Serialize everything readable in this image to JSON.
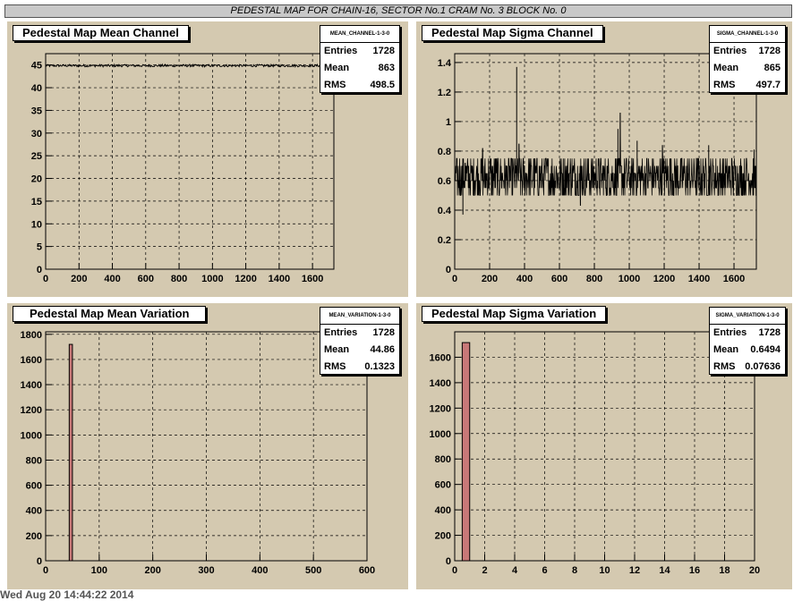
{
  "page": {
    "header": "PEDESTAL MAP FOR CHAIN-16, SECTOR No.1 CRAM No. 3 BLOCK No. 0",
    "footer": "Wed Aug 20 14:44:22 2014"
  },
  "colors": {
    "pad_bg": "#d4c9b0",
    "bar_fill": "#c87878",
    "line": "#000000"
  },
  "panels": [
    {
      "title": "Pedestal Map Mean Channel",
      "stats": {
        "name": "MEAN_CHANNEL-1-3-0",
        "entries_label": "Entries",
        "entries": "1728",
        "mean_label": "Mean",
        "mean": "863",
        "rms_label": "RMS",
        "rms": "498.5"
      }
    },
    {
      "title": "Pedestal Map Sigma Channel",
      "stats": {
        "name": "SIGMA_CHANNEL-1-3-0",
        "entries_label": "Entries",
        "entries": "1728",
        "mean_label": "Mean",
        "mean": "865",
        "rms_label": "RMS",
        "rms": "497.7"
      }
    },
    {
      "title": "Pedestal Map Mean Variation",
      "stats": {
        "name": "MEAN_VARIATION-1-3-0",
        "entries_label": "Entries",
        "entries": "1728",
        "mean_label": "Mean",
        "mean": "44.86",
        "rms_label": "RMS",
        "rms": "0.1323"
      }
    },
    {
      "title": "Pedestal Map Sigma Variation",
      "stats": {
        "name": "SIGMA_VARIATION-1-3-0",
        "entries_label": "Entries",
        "entries": "1728",
        "mean_label": "Mean",
        "mean": "0.6494",
        "rms_label": "RMS",
        "rms": "0.07636"
      }
    }
  ],
  "chart_data": [
    {
      "type": "line",
      "title": "Pedestal Map Mean Channel",
      "xlim": [
        0,
        1728
      ],
      "ylim": [
        0,
        47.5
      ],
      "x_ticks": [
        0,
        200,
        400,
        600,
        800,
        1000,
        1200,
        1400,
        1600
      ],
      "y_ticks": [
        0,
        5,
        10,
        15,
        20,
        25,
        30,
        35,
        40,
        45
      ],
      "grid": true,
      "series": [
        {
          "baseline": 44.86,
          "spread": 0.13
        }
      ]
    },
    {
      "type": "line",
      "title": "Pedestal Map Sigma Channel",
      "xlim": [
        0,
        1728
      ],
      "ylim": [
        0,
        1.46
      ],
      "x_ticks": [
        0,
        200,
        400,
        600,
        800,
        1000,
        1200,
        1400,
        1600
      ],
      "y_ticks": [
        0,
        0.2,
        0.4,
        0.6,
        0.8,
        1,
        1.2,
        1.4
      ],
      "grid": true,
      "series": [
        {
          "levels": [
            0.5,
            0.55,
            0.6,
            0.65,
            0.7,
            0.75
          ],
          "spikes": [
            {
              "x": 47,
              "y": 0.37
            },
            {
              "x": 60,
              "y": 0.72
            },
            {
              "x": 355,
              "y": 1.37
            },
            {
              "x": 368,
              "y": 0.85
            },
            {
              "x": 948,
              "y": 1.06
            },
            {
              "x": 935,
              "y": 0.95
            },
            {
              "x": 1045,
              "y": 0.87
            },
            {
              "x": 1190,
              "y": 0.84
            },
            {
              "x": 1455,
              "y": 0.84
            },
            {
              "x": 1715,
              "y": 0.81
            },
            {
              "x": 160,
              "y": 0.82
            },
            {
              "x": 720,
              "y": 0.43
            }
          ]
        }
      ]
    },
    {
      "type": "bar",
      "title": "Pedestal Map Mean Variation",
      "xlim": [
        0,
        600
      ],
      "ylim": [
        0,
        1820
      ],
      "x_ticks": [
        0,
        100,
        200,
        300,
        400,
        500,
        600
      ],
      "y_ticks": [
        0,
        200,
        400,
        600,
        800,
        1000,
        1200,
        1400,
        1600,
        1800
      ],
      "grid": true,
      "bars": [
        {
          "x0": 44,
          "x1": 50,
          "value": 1720
        }
      ]
    },
    {
      "type": "bar",
      "title": "Pedestal Map Sigma Variation",
      "xlim": [
        0,
        20
      ],
      "ylim": [
        0,
        1800
      ],
      "x_ticks": [
        0,
        2,
        4,
        6,
        8,
        10,
        12,
        14,
        16,
        18,
        20
      ],
      "y_ticks": [
        0,
        200,
        400,
        600,
        800,
        1000,
        1200,
        1400,
        1600
      ],
      "grid": true,
      "bars": [
        {
          "x0": 0.5,
          "x1": 1.0,
          "value": 1715
        }
      ]
    }
  ]
}
